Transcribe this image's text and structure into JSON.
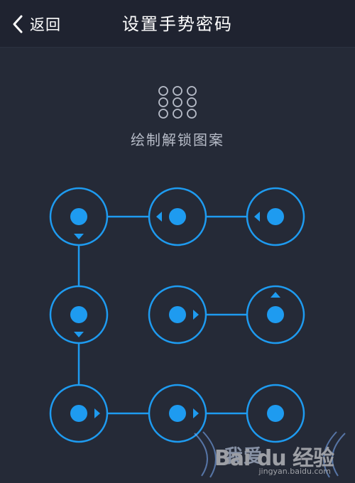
{
  "header": {
    "back_label": "返回",
    "title": "设置手势密码"
  },
  "hint": {
    "text": "绘制解锁图案"
  },
  "colors": {
    "background": "#252a37",
    "header": "#1f2330",
    "accent": "#1e9bf0",
    "text": "#ffffff",
    "hint_text": "#b7bcc8"
  },
  "pattern": {
    "nodes": [
      {
        "id": 1,
        "selected": true,
        "arrow": "down"
      },
      {
        "id": 2,
        "selected": true,
        "arrow": "left"
      },
      {
        "id": 3,
        "selected": true,
        "arrow": "left"
      },
      {
        "id": 4,
        "selected": true,
        "arrow": "down"
      },
      {
        "id": 5,
        "selected": true,
        "arrow": "right"
      },
      {
        "id": 6,
        "selected": true,
        "arrow": "up"
      },
      {
        "id": 7,
        "selected": true,
        "arrow": "right"
      },
      {
        "id": 8,
        "selected": true,
        "arrow": "right"
      },
      {
        "id": 9,
        "selected": true,
        "arrow": null
      }
    ],
    "sequence": [
      3,
      2,
      1,
      4,
      7,
      8,
      9
    ],
    "extra_links": [
      [
        5,
        6
      ]
    ]
  },
  "watermark": {
    "text": "我爱",
    "logo": "Bai du 经验",
    "url": "jingyan.baidu.com"
  }
}
